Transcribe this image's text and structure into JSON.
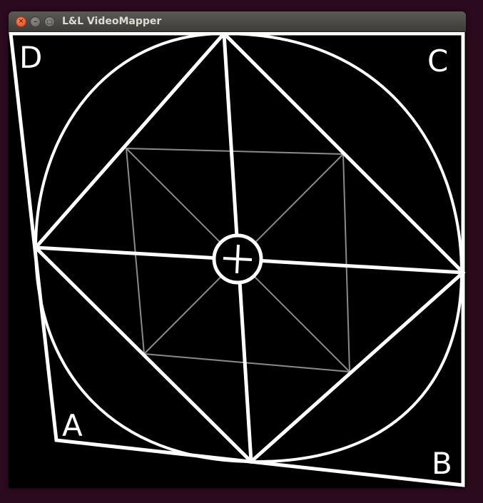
{
  "window": {
    "title": "L&L VideoMapper",
    "controls": {
      "close": "×",
      "minimize": "–",
      "maximize": "□"
    }
  },
  "canvas": {
    "background": "#000000",
    "line_color": "#ffffff",
    "inner_grid_color": "#8a8a8a",
    "corner_labels": {
      "top_left": "D",
      "top_right": "C",
      "bottom_left": "A",
      "bottom_right": "B"
    },
    "center_symbol": "+"
  }
}
